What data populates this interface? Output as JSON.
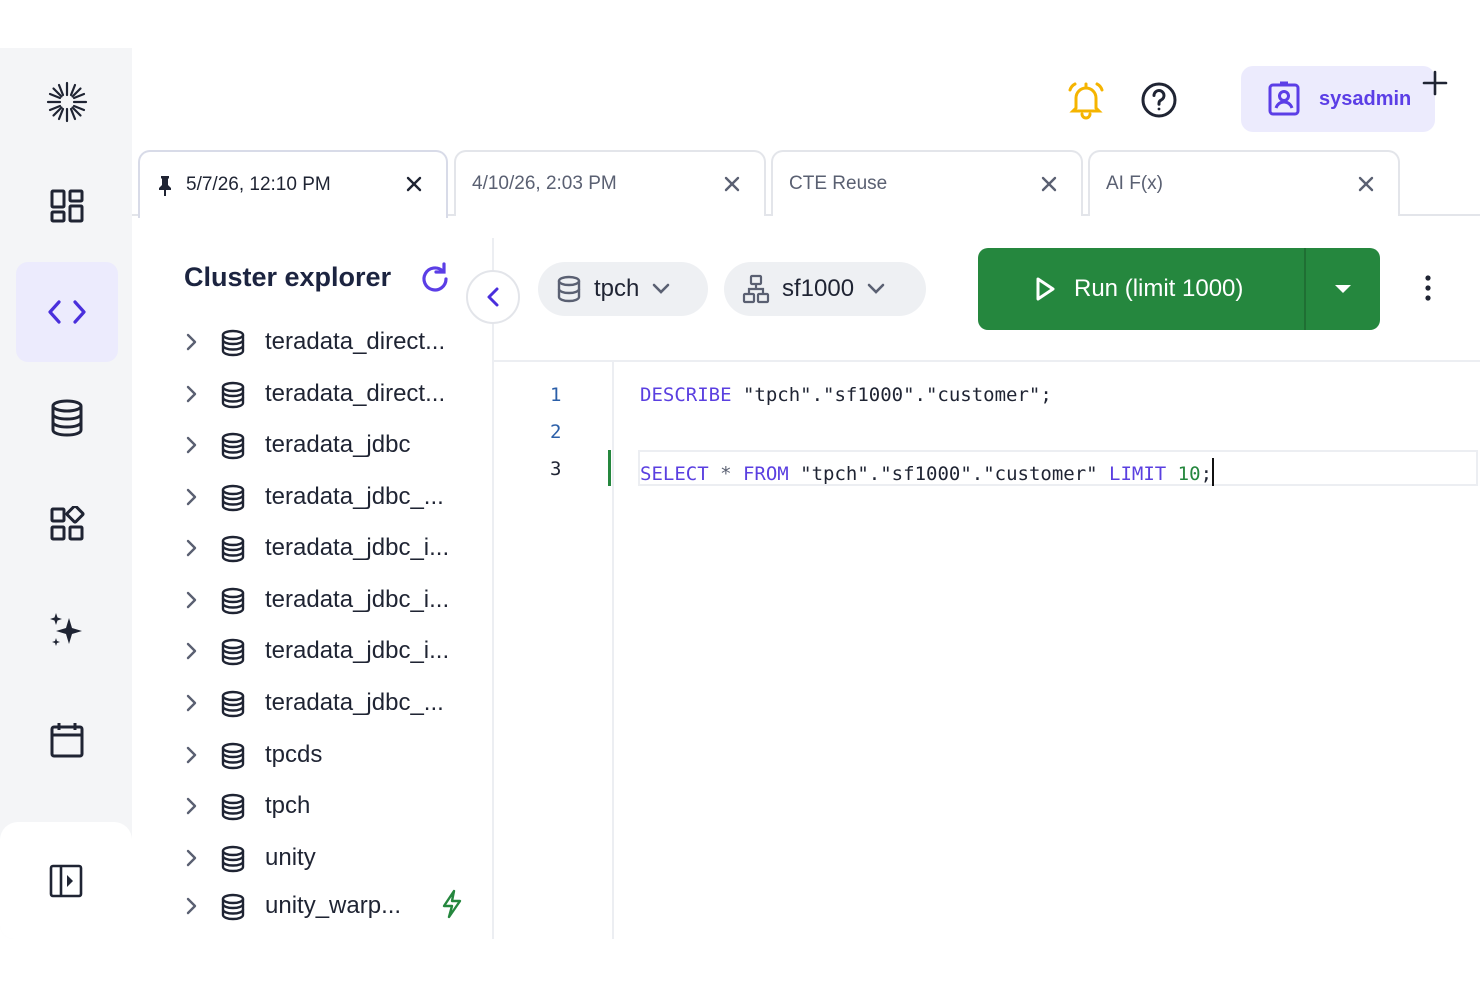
{
  "header": {
    "user_label": "sysadmin"
  },
  "tabs": [
    {
      "label": "5/7/26, 12:10 PM",
      "pinned": true,
      "active": true
    },
    {
      "label": "4/10/26, 2:03 PM",
      "pinned": false,
      "active": false
    },
    {
      "label": "CTE Reuse",
      "pinned": false,
      "active": false
    },
    {
      "label": "AI F(x)",
      "pinned": false,
      "active": false
    }
  ],
  "explorer": {
    "title": "Cluster explorer",
    "items": [
      {
        "label": "teradata_direct..."
      },
      {
        "label": "teradata_direct..."
      },
      {
        "label": "teradata_jdbc"
      },
      {
        "label": "teradata_jdbc_..."
      },
      {
        "label": "teradata_jdbc_i..."
      },
      {
        "label": "teradata_jdbc_i..."
      },
      {
        "label": "teradata_jdbc_i..."
      },
      {
        "label": "teradata_jdbc_..."
      },
      {
        "label": "tpcds"
      },
      {
        "label": "tpch"
      },
      {
        "label": "unity"
      },
      {
        "label": "unity_warp..."
      }
    ]
  },
  "toolbar": {
    "catalog": "tpch",
    "schema": "sf1000",
    "run_label": "Run (limit 1000)"
  },
  "editor": {
    "line_numbers": [
      "1",
      "2",
      "3"
    ],
    "line1": {
      "kw": "DESCRIBE",
      "rest": " \"tpch\".\"sf1000\".\"customer\";"
    },
    "line3": {
      "kw1": "SELECT",
      "op": " * ",
      "kw2": "FROM",
      "str": " \"tpch\".\"sf1000\".\"customer\" ",
      "kw3": "LIMIT",
      "num": " 10",
      "end": ";"
    }
  },
  "colors": {
    "accent": "#5b3ee6",
    "run_green": "#25873e",
    "bell_orange": "#f5b400",
    "rail_bg": "#f4f5f7"
  }
}
